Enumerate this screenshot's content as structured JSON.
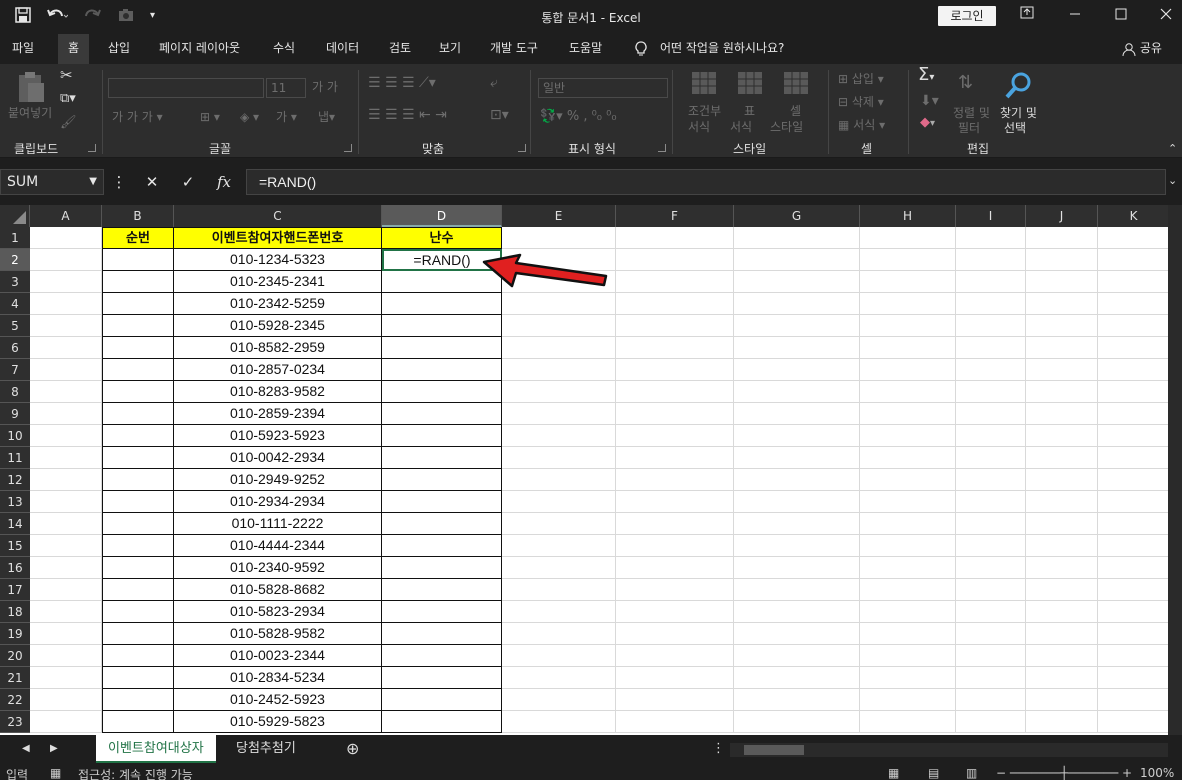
{
  "window": {
    "title": "통합 문서1  -  Excel",
    "login_label": "로그인"
  },
  "menu_tabs": [
    "파일",
    "홈",
    "삽입",
    "페이지 레이아웃",
    "수식",
    "데이터",
    "검토",
    "보기",
    "개발 도구",
    "도움말"
  ],
  "tell_me": "어떤 작업을 원하시나요?",
  "share_label": "공유",
  "ribbon": {
    "paste_label": "붙여넣기",
    "font_size": "11",
    "number_format": "일반",
    "conditional_format": [
      "조건부",
      "서식"
    ],
    "format_as_table": [
      "표",
      "서식"
    ],
    "cell_styles": [
      "셀",
      "스타일"
    ],
    "insert": "삽입",
    "delete": "삭제",
    "format": "서식",
    "sort_filter": [
      "정렬 및",
      "필터"
    ],
    "find_select": [
      "찾기 및",
      "선택"
    ],
    "groups": [
      "클립보드",
      "글꼴",
      "맞춤",
      "표시 형식",
      "스타일",
      "셀",
      "편집"
    ]
  },
  "formula_bar": {
    "name_box": "SUM",
    "formula": "=RAND()"
  },
  "columns": [
    "A",
    "B",
    "C",
    "D",
    "E",
    "F",
    "G",
    "H",
    "I",
    "J",
    "K"
  ],
  "rows": [
    "1",
    "2",
    "3",
    "4",
    "5",
    "6",
    "7",
    "8",
    "9",
    "10",
    "11",
    "12",
    "13",
    "14",
    "15",
    "16",
    "17",
    "18",
    "19",
    "20",
    "21",
    "22",
    "23"
  ],
  "table": {
    "headers": [
      "순번",
      "이벤트참여자핸드폰번호",
      "난수"
    ],
    "phones": [
      "010-1234-5323",
      "010-2345-2341",
      "010-2342-5259",
      "010-5928-2345",
      "010-8582-2959",
      "010-2857-0234",
      "010-8283-9582",
      "010-2859-2394",
      "010-5923-5923",
      "010-0042-2934",
      "010-2949-9252",
      "010-2934-2934",
      "010-1111-2222",
      "010-4444-2344",
      "010-2340-9592",
      "010-5828-8682",
      "010-5823-2934",
      "010-5828-9582",
      "010-0023-2344",
      "010-2834-5234",
      "010-2452-5923",
      "010-5929-5823"
    ],
    "active_cell_text": "=RAND()"
  },
  "sheets": [
    "이벤트참여대상자",
    "당첨추첨기"
  ],
  "status": {
    "mode": "입력",
    "accessibility": "접근성: 계속 진행 가능",
    "zoom": "100%"
  },
  "colors": {
    "header_fill": "#ffff00",
    "arrow": "#e02020",
    "active_sheet": "#217346"
  }
}
